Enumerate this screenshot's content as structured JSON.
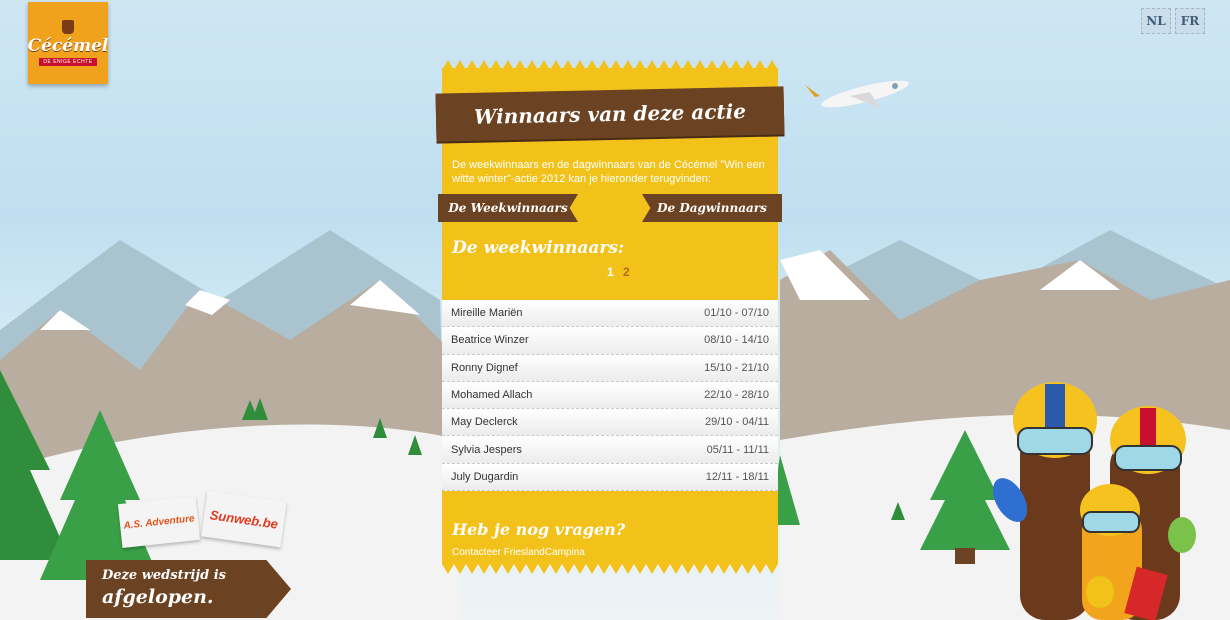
{
  "brand": {
    "name": "Cécémel",
    "tagline": "DE ENIGE ECHTE"
  },
  "lang": {
    "nl": "NL",
    "fr": "FR"
  },
  "panel": {
    "title": "Winnaars van deze actie",
    "intro": "De weekwinnaars en de dagwinnaars van de Cécémel \"Win een witte winter\"-actie 2012 kan je hieronder terugvinden:",
    "tabs": {
      "week": "De Weekwinnaars",
      "day": "De Dagwinnaars"
    },
    "section_title": "De weekwinnaars:",
    "pages": [
      "1",
      "2"
    ],
    "winners": [
      {
        "name": "Mireille Mariën",
        "date": "01/10 - 07/10"
      },
      {
        "name": "Beatrice Winzer",
        "date": "08/10 - 14/10"
      },
      {
        "name": "Ronny Dignef",
        "date": "15/10 - 21/10"
      },
      {
        "name": "Mohamed Allach",
        "date": "22/10 - 28/10"
      },
      {
        "name": "May Declerck",
        "date": "29/10 - 04/11"
      },
      {
        "name": "Sylvia Jespers",
        "date": "05/11 - 11/11"
      },
      {
        "name": "July Dugardin",
        "date": "12/11 - 18/11"
      }
    ],
    "question": "Heb je nog vragen?",
    "contact": "Contacteer FrieslandCampina"
  },
  "sign": {
    "line1": "Deze wedstrijd is",
    "line2": "afgelopen."
  },
  "sponsors": {
    "left": "A.S. Adventure",
    "right": "Sunweb.be"
  },
  "colors": {
    "panel": "#f2c21b",
    "wood": "#6b4222",
    "logo_bg": "#f0a21c"
  }
}
